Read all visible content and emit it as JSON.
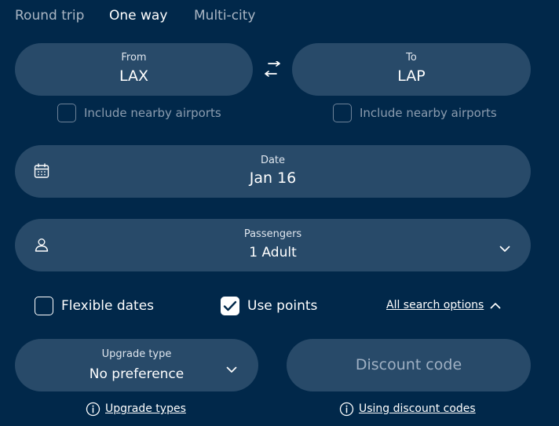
{
  "trip_tabs": [
    {
      "label": "Round trip",
      "active": false
    },
    {
      "label": "One way",
      "active": true
    },
    {
      "label": "Multi-city",
      "active": false
    }
  ],
  "from": {
    "label": "From",
    "value": "LAX"
  },
  "to": {
    "label": "To",
    "value": "LAP"
  },
  "nearby_airports": {
    "from_label": "Include nearby airports",
    "to_label": "Include nearby airports",
    "from_checked": false,
    "to_checked": false
  },
  "date": {
    "label": "Date",
    "value": "Jan 16"
  },
  "passengers": {
    "label": "Passengers",
    "value": "1 Adult"
  },
  "options": {
    "flexible_dates": {
      "label": "Flexible dates",
      "checked": false
    },
    "use_points": {
      "label": "Use points",
      "checked": true
    },
    "all_search_options": "All search options"
  },
  "upgrade": {
    "label": "Upgrade type",
    "value": "No preference"
  },
  "discount": {
    "placeholder": "Discount code"
  },
  "links": {
    "upgrade_types": "Upgrade types",
    "using_discount_codes": "Using discount codes"
  },
  "icons": {
    "swap": "swap-arrows-icon",
    "date": "calendar-icon",
    "passengers": "person-icon",
    "dropdown": "chevron-down-icon",
    "collapse": "chevron-up-icon",
    "info": "info-icon"
  },
  "colors": {
    "background": "#01284a",
    "field": "#284a69",
    "text": "#ffffff",
    "muted": "#aab6c4"
  }
}
